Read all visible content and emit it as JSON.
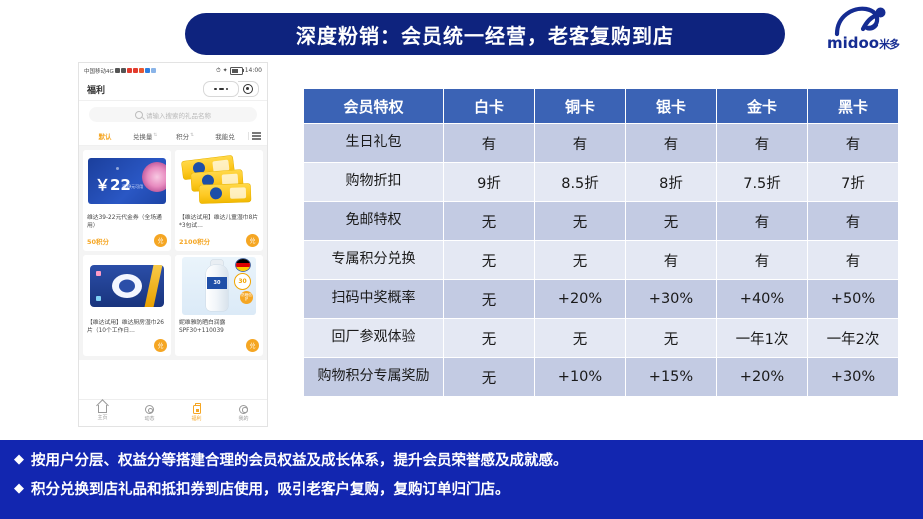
{
  "header": {
    "title": "深度粉销：会员统一经营，老客复购到店",
    "title_bg": "#0E237E",
    "logo": {
      "brand": "midoo",
      "brand_cn": "米多",
      "color": "#152C92",
      "icon": "midoo-running-figure-logo"
    }
  },
  "phone": {
    "status_bar": {
      "carrier": "中国移动4G",
      "time": "14:00"
    },
    "nav": {
      "page_title": "福利",
      "menu_icon": "more-dots-icon",
      "target_icon": "target-circle-icon"
    },
    "search": {
      "placeholder": "请输入搜索的礼品名称",
      "icon": "search-icon"
    },
    "tabs": [
      {
        "label": "默认",
        "active": true,
        "sortable": false
      },
      {
        "label": "兑换量",
        "active": false,
        "sortable": true
      },
      {
        "label": "积分",
        "active": false,
        "sortable": true
      },
      {
        "label": "我能兑",
        "active": false,
        "sortable": false
      }
    ],
    "view_toggle_icon": "list-view-icon",
    "cards": [
      {
        "title": "维达39-22元代金券（全场通用）",
        "points": "50积分",
        "art": "coupon",
        "amount": "￥22",
        "amount_sub": "满39元可用",
        "action": "兑"
      },
      {
        "title": "【维达试用】维达儿童湿巾8片*3包试…",
        "points": "2100积分",
        "art": "wipes",
        "action": "兑"
      },
      {
        "title": "【维达试用】维达厨房湿巾26片（10个工作日…",
        "points": "",
        "art": "kitchen-wipes",
        "action": "兑"
      },
      {
        "title": "妮维雅防晒白润露SPF30+110039",
        "points": "",
        "art": "nivea",
        "badge": "30",
        "badge_small": "防晒倍护",
        "action": "兑"
      }
    ],
    "tabbar": [
      {
        "label": "主页",
        "icon": "home-icon",
        "active": false
      },
      {
        "label": "动态",
        "icon": "compass-icon",
        "active": false
      },
      {
        "label": "福利",
        "icon": "gift-icon",
        "active": true
      },
      {
        "label": "我的",
        "icon": "user-icon",
        "active": false
      }
    ]
  },
  "table": {
    "header_bg": "#3B63B5",
    "row_odd_bg": "#C3CBE3",
    "row_even_bg": "#E4E8F3",
    "columns": [
      "会员特权",
      "白卡",
      "铜卡",
      "银卡",
      "金卡",
      "黑卡"
    ],
    "rows": [
      {
        "feature": "生日礼包",
        "values": [
          "有",
          "有",
          "有",
          "有",
          "有"
        ]
      },
      {
        "feature": "购物折扣",
        "values": [
          "9折",
          "8.5折",
          "8折",
          "7.5折",
          "7折"
        ]
      },
      {
        "feature": "免邮特权",
        "values": [
          "无",
          "无",
          "无",
          "有",
          "有"
        ]
      },
      {
        "feature": "专属积分兑换",
        "values": [
          "无",
          "无",
          "有",
          "有",
          "有"
        ]
      },
      {
        "feature": "扫码中奖概率",
        "values": [
          "无",
          "+20%",
          "+30%",
          "+40%",
          "+50%"
        ]
      },
      {
        "feature": "回厂参观体验",
        "values": [
          "无",
          "无",
          "无",
          "一年1次",
          "一年2次"
        ]
      },
      {
        "feature": "购物积分专属奖励",
        "values": [
          "无",
          "+10%",
          "+15%",
          "+20%",
          "+30%"
        ]
      }
    ]
  },
  "footer": {
    "bg": "#1226B0",
    "bullet_glyph": "◆",
    "bullets": [
      "按用户分层、权益分等搭建合理的会员权益及成长体系，提升会员荣誉感及成就感。",
      "积分兑换到店礼品和抵扣券到店使用，吸引老客户复购，复购订单归门店。"
    ]
  }
}
